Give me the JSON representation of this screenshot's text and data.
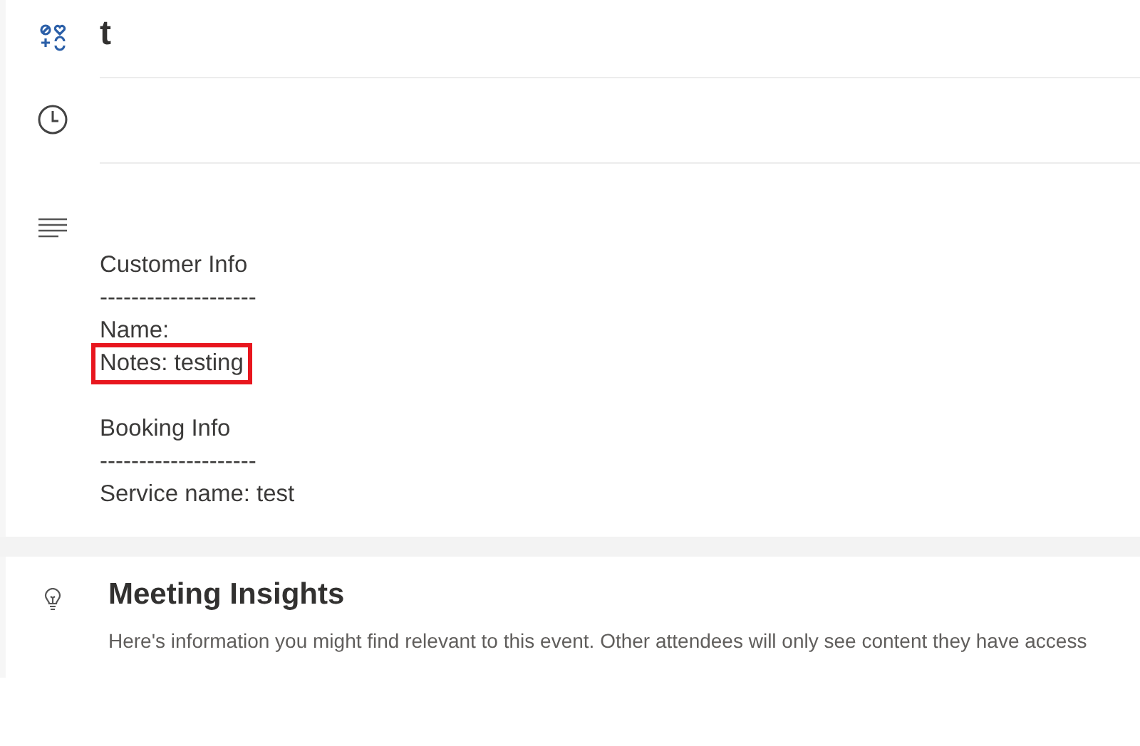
{
  "event": {
    "title": "t"
  },
  "notes": {
    "sections": [
      {
        "heading": "Customer Info",
        "rule": "--------------------",
        "lines": [
          {
            "text": "Name:",
            "highlighted": false
          },
          {
            "text": "Notes: testing",
            "highlighted": true
          }
        ]
      },
      {
        "heading": "Booking Info",
        "rule": "--------------------",
        "lines": [
          {
            "text": "Service name: test",
            "highlighted": false
          }
        ]
      }
    ]
  },
  "insights": {
    "title": "Meeting Insights",
    "description": "Here's information you might find relevant to this event. Other attendees will only see content they have access"
  }
}
